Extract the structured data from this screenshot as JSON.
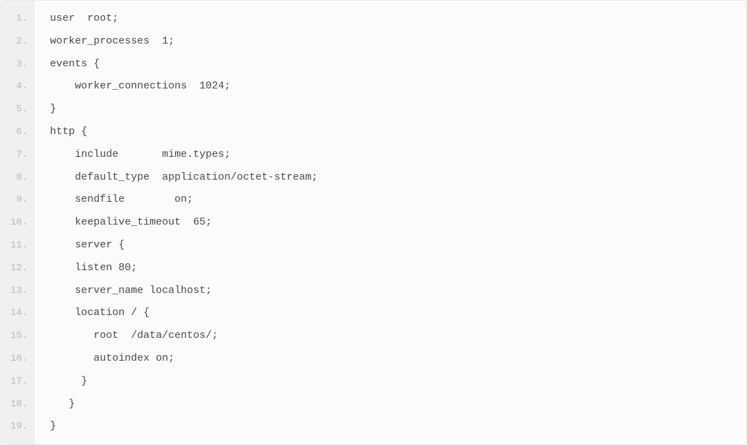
{
  "code": {
    "lines": [
      {
        "num": "1.",
        "text": "user  root;"
      },
      {
        "num": "2.",
        "text": "worker_processes  1;"
      },
      {
        "num": "3.",
        "text": "events {"
      },
      {
        "num": "4.",
        "text": "    worker_connections  1024;"
      },
      {
        "num": "5.",
        "text": "}"
      },
      {
        "num": "6.",
        "text": "http {"
      },
      {
        "num": "7.",
        "text": "    include       mime.types;"
      },
      {
        "num": "8.",
        "text": "    default_type  application/octet-stream;"
      },
      {
        "num": "9.",
        "text": "    sendfile        on;"
      },
      {
        "num": "10.",
        "text": "    keepalive_timeout  65;"
      },
      {
        "num": "11.",
        "text": "    server {"
      },
      {
        "num": "12.",
        "text": "    listen 80;"
      },
      {
        "num": "13.",
        "text": "    server_name localhost;"
      },
      {
        "num": "14.",
        "text": "    location / {"
      },
      {
        "num": "15.",
        "text": "       root  /data/centos/;"
      },
      {
        "num": "16.",
        "text": "       autoindex on;"
      },
      {
        "num": "17.",
        "text": "     }"
      },
      {
        "num": "18.",
        "text": "   }"
      },
      {
        "num": "19.",
        "text": "}"
      }
    ]
  }
}
